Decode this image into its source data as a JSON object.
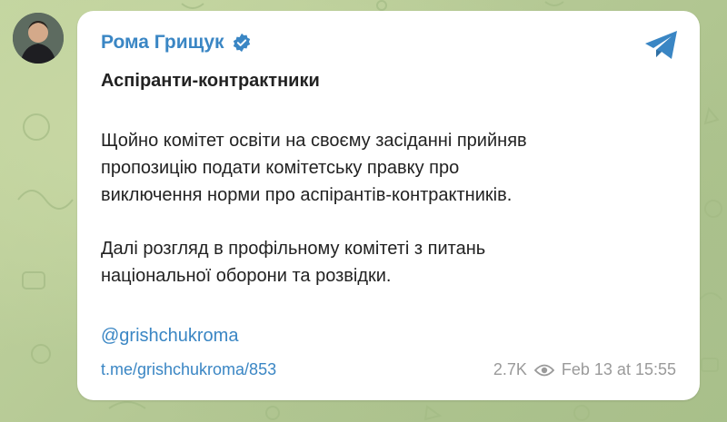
{
  "post": {
    "author": "Рома Грищук",
    "title": "Аспіранти-контрактники",
    "paragraph1": [
      "Щойно комітет освіти на своєму засіданні прийняв",
      "пропозицію подати комітетську правку про",
      "виключення норми про аспірантів-контрактників."
    ],
    "paragraph2": [
      "Далі розгляд в профільному комітеті з питань",
      "національної оборони та розвідки."
    ],
    "handle": "@grishchukroma",
    "link": "t.me/grishchukroma/853",
    "views": "2.7K",
    "date": "Feb 13 at 15:55"
  },
  "icons": {
    "verified": "verified-badge-icon",
    "telegram": "telegram-icon",
    "views": "eye-icon"
  },
  "colors": {
    "accent": "#3a86c4",
    "background": "#b9cc9a",
    "card": "#ffffff",
    "text": "#222222",
    "meta": "#9a9a9a"
  }
}
